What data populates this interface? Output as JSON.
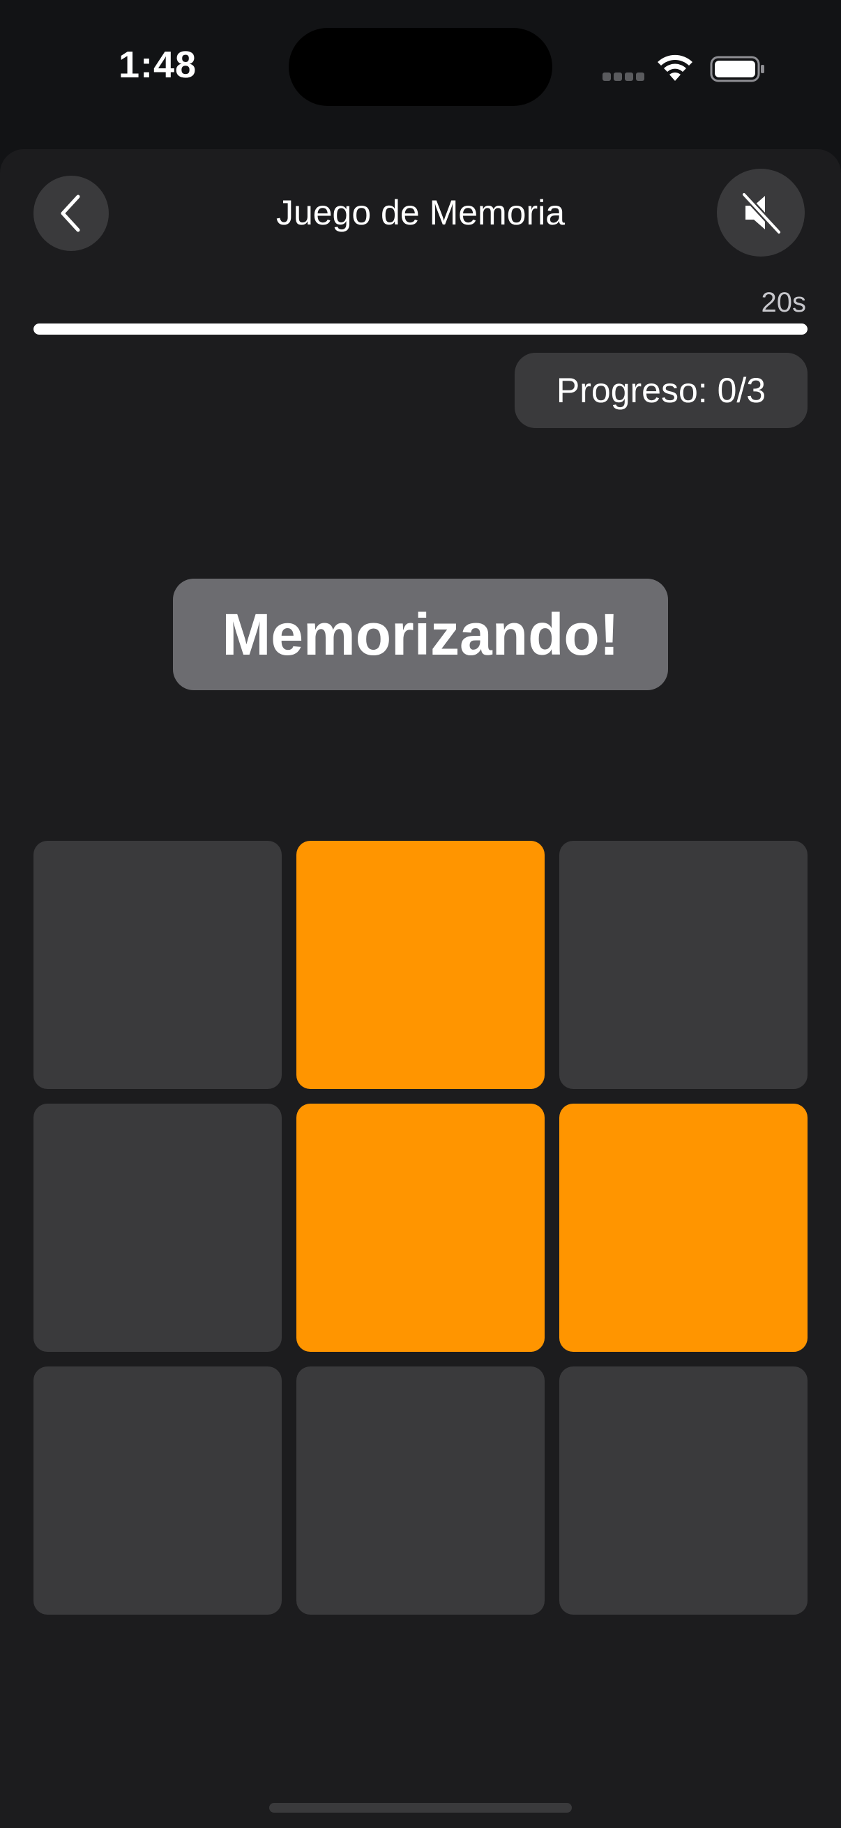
{
  "status_bar": {
    "time": "1:48",
    "icons": [
      "cellular-signal-icon",
      "wifi-icon",
      "battery-icon"
    ]
  },
  "header": {
    "title": "Juego de Memoria",
    "back_icon": "chevron-left-icon",
    "sound_icon": "speaker-muted-icon"
  },
  "timer": {
    "label": "20s",
    "remaining_fraction": 1.0
  },
  "progress": {
    "label": "Progreso: 0/3"
  },
  "banner": {
    "text": "Memorizando!"
  },
  "grid": {
    "rows": 3,
    "columns": 3,
    "cells": [
      false,
      true,
      false,
      false,
      true,
      true,
      false,
      false,
      false
    ]
  },
  "colors": {
    "accent": "#ff9500",
    "tile": "#3a3a3c",
    "sheet_background": "#1c1c1e",
    "banner_background": "#6c6c70"
  }
}
